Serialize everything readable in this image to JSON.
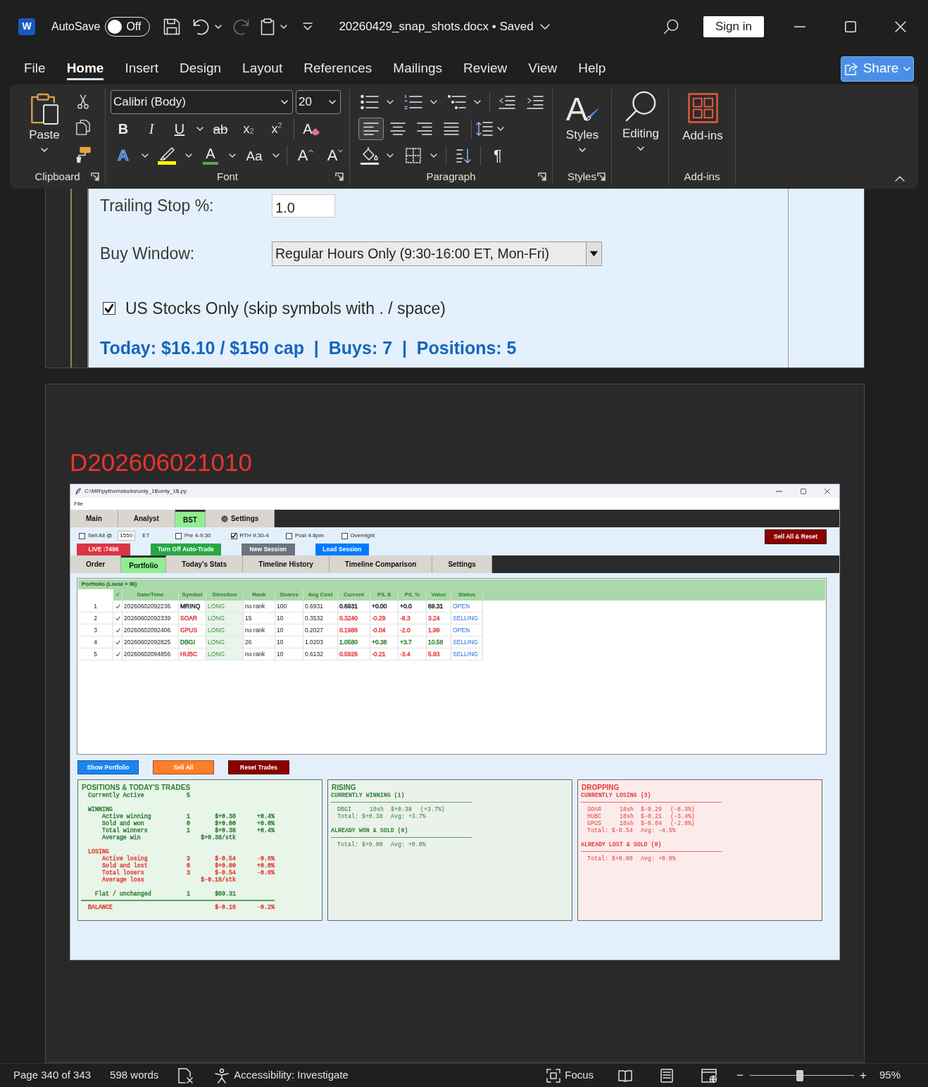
{
  "title_bar": {
    "app_glyph": "W",
    "autosave": {
      "label": "AutoSave",
      "on": false,
      "state": "Off"
    },
    "document": "20260429_snap_shots.docx • Saved",
    "sign_in": "Sign in"
  },
  "menu": {
    "tabs": [
      {
        "label": "File",
        "selected": false
      },
      {
        "label": "Home",
        "selected": true
      },
      {
        "label": "Insert",
        "selected": false
      },
      {
        "label": "Design",
        "selected": false
      },
      {
        "label": "Layout",
        "selected": false
      },
      {
        "label": "References",
        "selected": false
      },
      {
        "label": "Mailings",
        "selected": false
      },
      {
        "label": "Review",
        "selected": false
      },
      {
        "label": "View",
        "selected": false
      },
      {
        "label": "Help",
        "selected": false
      }
    ],
    "share": "Share"
  },
  "ribbon": {
    "clipboard": {
      "paste": "Paste",
      "label": "Clipboard"
    },
    "font": {
      "name": "Calibri (Body)",
      "size": "20",
      "format": [
        {
          "kind": "bold",
          "glyph": "B",
          "menu": false
        },
        {
          "kind": "italic",
          "glyph": "I",
          "menu": false
        },
        {
          "kind": "underline",
          "glyph": "U",
          "menu": true
        },
        {
          "kind": "strike",
          "glyph": "ab",
          "menu": false
        },
        {
          "kind": "subscript",
          "glyph": "x$_{2}$",
          "menu": false
        },
        {
          "kind": "superscript",
          "glyph": "x$^{2}$",
          "menu": false
        },
        {
          "kind": "clear",
          "glyph": "A",
          "menu": false
        }
      ],
      "effects": [
        {
          "kind": "effects",
          "glyph": "A",
          "menu": true
        },
        {
          "kind": "highlight",
          "menu": true
        },
        {
          "kind": "color",
          "glyph": "A",
          "menu": true
        },
        {
          "kind": "case",
          "glyph": "Aa",
          "menu": true
        },
        {
          "kind": "grow",
          "glyph": "A",
          "menu": false
        },
        {
          "kind": "shrink",
          "glyph": "A",
          "menu": false
        }
      ],
      "label": "Font"
    },
    "paragraph": {
      "lists": [
        {
          "kind": "bullets",
          "menu": true
        },
        {
          "kind": "numbering",
          "menu": true
        },
        {
          "kind": "multilevel",
          "menu": true
        },
        {
          "kind": "outdent",
          "menu": false
        },
        {
          "kind": "indent",
          "menu": false
        }
      ],
      "alignment": [
        {
          "kind": "left",
          "selected": true
        },
        {
          "kind": "center",
          "selected": false
        },
        {
          "kind": "right",
          "selected": false
        },
        {
          "kind": "justify",
          "selected": false
        }
      ],
      "line_spacing": {
        "menu": true
      },
      "tools": [
        {
          "kind": "shading",
          "menu": true
        },
        {
          "kind": "borders",
          "menu": true
        },
        {
          "kind": "sort",
          "menu": false
        },
        {
          "kind": "marks",
          "glyph": "¶",
          "menu": false
        }
      ],
      "label": "Paragraph"
    },
    "styles": {
      "glyph": "A",
      "button": "Styles",
      "label": "Styles"
    },
    "editing": {
      "button": "Editing"
    },
    "addins": {
      "button": "Add-ins",
      "label": "Add-ins"
    }
  },
  "document": {
    "page_one": {
      "trailing_stop": {
        "label": "Trailing Stop %:",
        "value": "1.0"
      },
      "buy_window": {
        "label": "Buy Window:",
        "value": "Regular Hours Only (9:30-16:00 ET, Mon-Fri)"
      },
      "us_only": {
        "label": "US Stocks Only (skip symbols with . / space)",
        "checked": true
      },
      "summary": "Today: $16.10 / $150 cap  |  Buys: 7  |  Positions: 5"
    },
    "page_two": {
      "heading": "D202606021010",
      "app": {
        "title": "C:\\MR\\python\\stocks\\only_1$\\only_1$.py",
        "menu": [
          "File"
        ],
        "tabs": [
          {
            "label": "Main",
            "selected": false
          },
          {
            "label": "Analyst",
            "selected": false
          },
          {
            "label": "BST",
            "selected": true
          },
          {
            "label": "Settings",
            "selected": false
          }
        ],
        "options": {
          "sell_all": {
            "label": "Sell All @",
            "checked": false,
            "time": "1550",
            "unit": "ET"
          },
          "sessions": [
            {
              "label": "Pre 4-9:30",
              "checked": false
            },
            {
              "label": "RTH 9:30-4",
              "checked": true
            },
            {
              "label": "Post 4-8pm",
              "checked": false
            },
            {
              "label": "Overnight",
              "checked": false
            }
          ],
          "reset": "Sell All & Reset"
        },
        "actions": [
          {
            "label": "LIVE :7496",
            "color": "#dc3545"
          },
          {
            "label": "Turn Off Auto-Trade",
            "color": "#28a745"
          },
          {
            "label": "New Session",
            "color": "#6c757d"
          },
          {
            "label": "Load Session",
            "color": "#007bff"
          }
        ],
        "views": [
          {
            "label": "Order",
            "selected": false
          },
          {
            "label": "Portfolio",
            "selected": true
          },
          {
            "label": "Today's Stats",
            "selected": false
          },
          {
            "label": "Timeline History",
            "selected": false
          },
          {
            "label": "Timeline Comparison",
            "selected": false
          },
          {
            "label": "Settings",
            "selected": false
          }
        ],
        "portfolio": {
          "title": "Portfolio (Local + IB)",
          "columns": [
            "✓",
            "Date/Time",
            "Symbol",
            "Direction",
            "Rank",
            "Shares",
            "Avg Cost",
            "Current",
            "P/L $",
            "P/L %",
            "Value",
            "Status"
          ],
          "rows": [
            {
              "index": "1",
              "checked": true,
              "color": "#222222",
              "time": "20260602092236",
              "symbol": "MRINQ",
              "direction": "LONG",
              "rank": "no rank",
              "shares": "100",
              "avg_cost": "0.6931",
              "current": "0.6931",
              "pl": "+0.00",
              "pl_pct": "+0.0",
              "value": "69.31",
              "status": "OPEN"
            },
            {
              "index": "2",
              "checked": true,
              "color": "#e53935",
              "time": "20260602092339",
              "symbol": "SOAR",
              "direction": "LONG",
              "rank": "15",
              "shares": "10",
              "avg_cost": "0.3532",
              "current": "0.3240",
              "pl": "-0.29",
              "pl_pct": "-8.3",
              "value": "3.24",
              "status": "SELLING"
            },
            {
              "index": "3",
              "checked": true,
              "color": "#e53935",
              "time": "20260602092406",
              "symbol": "GPUS",
              "direction": "LONG",
              "rank": "no rank",
              "shares": "10",
              "avg_cost": "0.2027",
              "current": "0.1986",
              "pl": "-0.04",
              "pl_pct": "-2.0",
              "value": "1.99",
              "status": "OPEN"
            },
            {
              "index": "4",
              "checked": true,
              "color": "#2e7d32",
              "time": "20260602092825",
              "symbol": "DBGI",
              "direction": "LONG",
              "rank": "26",
              "shares": "10",
              "avg_cost": "1.0203",
              "current": "1.0580",
              "pl": "+0.38",
              "pl_pct": "+3.7",
              "value": "10.58",
              "status": "SELLING"
            },
            {
              "index": "5",
              "checked": true,
              "color": "#e53935",
              "time": "20260602094856",
              "symbol": "HUBC",
              "direction": "LONG",
              "rank": "no rank",
              "shares": "10",
              "avg_cost": "0.6132",
              "current": "0.5926",
              "pl": "-0.21",
              "pl_pct": "-3.4",
              "value": "5.93",
              "status": "SELLING"
            }
          ]
        },
        "buttons": [
          {
            "label": "Show Portfolio",
            "color": "#1a84f0"
          },
          {
            "label": "Sell All",
            "color": "#ff7f27"
          },
          {
            "label": "Reset Trades",
            "color": "#8b0000"
          }
        ],
        "positions": {
          "title": "POSITIONS & TODAY'S TRADES",
          "lines": [
            {
              "kind": "line",
              "color": "#2e7d32",
              "label": "Currently Active",
              "count": "5"
            },
            {
              "kind": "group",
              "color": "#2e7d32",
              "label": "WINNING",
              "children": [
                {
                  "label": "Active winning",
                  "count": "1",
                  "amount": "$+0.38",
                  "pct": "+0.4%"
                },
                {
                  "label": "Sold and won",
                  "count": "0",
                  "amount": "$+0.00",
                  "pct": "+0.0%"
                },
                {
                  "label": "Total winners",
                  "count": "1",
                  "amount": "$+0.38",
                  "pct": "+0.4%"
                },
                {
                  "label": "Average win",
                  "amount": "$+0.38/stk"
                }
              ]
            },
            {
              "kind": "group",
              "color": "#e53935",
              "label": "LOSING",
              "children": [
                {
                  "label": "Active losing",
                  "count": "3",
                  "amount": "$-0.54",
                  "pct": "-0.6%"
                },
                {
                  "label": "Sold and lost",
                  "count": "0",
                  "amount": "$+0.00",
                  "pct": "+0.0%"
                },
                {
                  "label": "Total losers",
                  "count": "3",
                  "amount": "$-0.54",
                  "pct": "-0.6%"
                },
                {
                  "label": "Average loss",
                  "amount": "$-0.18/stk"
                }
              ]
            },
            {
              "kind": "flat",
              "color": "#2e7d32",
              "label": "Flat / unchanged",
              "count": "1",
              "amount": "$69.31"
            },
            {
              "kind": "total",
              "color": "#e53935",
              "label": "BALANCE",
              "amount": "$-0.16",
              "pct": "-0.2%"
            }
          ]
        },
        "movers": [
          {
            "title": "RISING",
            "color": "#2e7d32",
            "sections": [
              {
                "heading": "CURRENTLY WINNING (1)",
                "entries": [
                  {
                    "symbol": "DBGI",
                    "shares": "10sh",
                    "amount": "$+0.38",
                    "pct": "(+3.7%)"
                  }
                ],
                "total": "Total: $+0.38",
                "avg": "Avg: +3.7%"
              },
              {
                "heading": "ALREADY WON & SOLD (0)",
                "total": "Total: $+0.00",
                "avg": "Avg: +0.0%"
              }
            ]
          },
          {
            "title": "DROPPING",
            "color": "#e53935",
            "sections": [
              {
                "heading": "CURRENTLY LOSING (3)",
                "entries": [
                  {
                    "symbol": "SOAR",
                    "shares": "10sh",
                    "amount": "$-0.29",
                    "pct": "(-8.3%)"
                  },
                  {
                    "symbol": "HUBC",
                    "shares": "10sh",
                    "amount": "$-0.21",
                    "pct": "(-3.4%)"
                  },
                  {
                    "symbol": "GPUS",
                    "shares": "10sh",
                    "amount": "$-0.04",
                    "pct": "(-2.0%)"
                  }
                ],
                "total": "Total: $-0.54",
                "avg": "Avg: -4.5%"
              },
              {
                "heading": "ALREADY LOST & SOLD (0)",
                "total": "Total: $+0.00",
                "avg": "Avg: +0.0%"
              }
            ]
          }
        ]
      }
    }
  },
  "status_bar": {
    "page": "Page 340 of 343",
    "words": "598 words",
    "accessibility": "Accessibility: Investigate",
    "focus": "Focus",
    "zoom": {
      "out": "−",
      "level": 0.48,
      "in": "+",
      "reading": "95%"
    }
  }
}
